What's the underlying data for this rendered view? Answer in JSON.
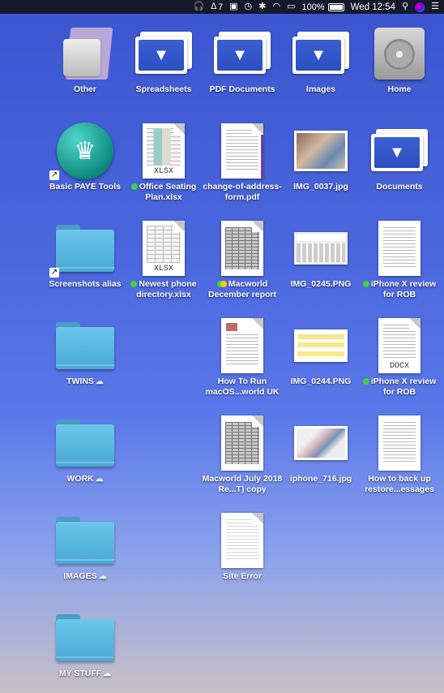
{
  "menubar": {
    "items": [
      {
        "icon": "headphones-icon",
        "text": ""
      },
      {
        "icon": "adobe-icon",
        "text": "7"
      },
      {
        "icon": "camera-off-icon",
        "text": ""
      },
      {
        "icon": "time-machine-icon",
        "text": ""
      },
      {
        "icon": "bluetooth-icon",
        "text": ""
      },
      {
        "icon": "wifi-icon",
        "text": ""
      },
      {
        "icon": "airplay-icon",
        "text": ""
      },
      {
        "icon": "battery-icon",
        "text": "100%"
      },
      {
        "icon": "clock",
        "text": "Wed 12:54"
      },
      {
        "icon": "search-icon",
        "text": ""
      },
      {
        "icon": "siri-icon",
        "text": ""
      },
      {
        "icon": "list-icon",
        "text": ""
      }
    ]
  },
  "desktop": {
    "other": {
      "label": "Other"
    },
    "spreadsheets": {
      "label": "Spreadsheets"
    },
    "pdf_documents": {
      "label": "PDF Documents"
    },
    "images": {
      "label": "Images"
    },
    "home": {
      "label": "Home"
    },
    "basic_paye": {
      "label": "Basic PAYE Tools"
    },
    "office_seating": {
      "label": "Office Seating Plan.xlsx",
      "tag": "green",
      "ext": "XLSX"
    },
    "change_of_address": {
      "label": "change-of-address-form.pdf"
    },
    "img_0037": {
      "label": "IMG_0037.jpg"
    },
    "documents": {
      "label": "Documents"
    },
    "screenshots_alias": {
      "label": "Screenshots alias"
    },
    "newest_phone": {
      "label": "Newest phone directory.xlsx",
      "tag": "green",
      "ext": "XLSX"
    },
    "macworld_dec": {
      "label": "Macworld December report",
      "tag": "green-yellow"
    },
    "img_0245": {
      "label": "IMG_0245.PNG"
    },
    "iphone_x_1": {
      "label": "iPhone X review for ROB",
      "tag": "green"
    },
    "twins": {
      "label": "TWINS"
    },
    "how_to_run": {
      "label": "How To Run macOS...world UK"
    },
    "img_0244": {
      "label": "IMG_0244.PNG"
    },
    "iphone_x_2": {
      "label": "iPhone X review for ROB",
      "tag": "green",
      "ext": "DOCX"
    },
    "work": {
      "label": "WORK"
    },
    "macworld_july": {
      "label": "Macworld July 2018 Re...T) copy"
    },
    "iphone_716": {
      "label": "iphone_716.jpg"
    },
    "how_to_backup": {
      "label": "How to back up restore...essages"
    },
    "images_folder": {
      "label": "IMAGES"
    },
    "site_error": {
      "label": "Site Error"
    },
    "my_stuff": {
      "label": "MY STUFF"
    }
  },
  "colors": {
    "tag_green": "#3ed13e",
    "tag_yellow": "#f2d100",
    "folder_blue": "#5ab8e2"
  }
}
